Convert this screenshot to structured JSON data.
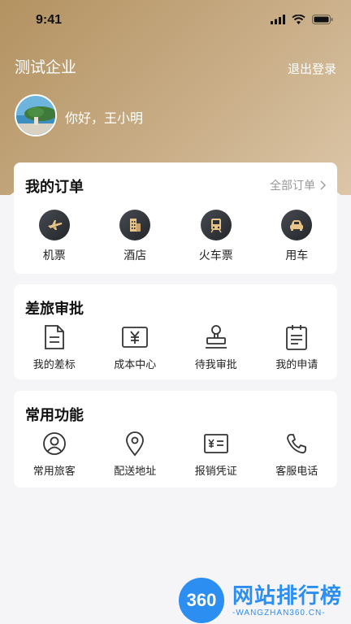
{
  "status_bar": {
    "time": "9:41"
  },
  "header": {
    "company": "测试企业",
    "logout": "退出登录",
    "greeting": "你好，王小明"
  },
  "orders": {
    "title": "我的订单",
    "all_link": "全部订单",
    "items": [
      {
        "label": "机票",
        "icon": "plane-icon"
      },
      {
        "label": "酒店",
        "icon": "hotel-icon"
      },
      {
        "label": "火车票",
        "icon": "train-icon"
      },
      {
        "label": "用车",
        "icon": "car-icon"
      }
    ]
  },
  "approval": {
    "title": "差旅审批",
    "items": [
      {
        "label": "我的差标",
        "icon": "document-icon"
      },
      {
        "label": "成本中心",
        "icon": "yuan-icon"
      },
      {
        "label": "待我审批",
        "icon": "stamp-icon"
      },
      {
        "label": "我的申请",
        "icon": "clipboard-icon"
      }
    ]
  },
  "functions": {
    "title": "常用功能",
    "items": [
      {
        "label": "常用旅客",
        "icon": "person-icon"
      },
      {
        "label": "配送地址",
        "icon": "location-icon"
      },
      {
        "label": "报销凭证",
        "icon": "receipt-icon"
      },
      {
        "label": "客服电话",
        "icon": "phone-icon"
      }
    ]
  },
  "watermark": {
    "logo": "360",
    "title": "网站排行榜",
    "subtitle": "-WANGZHAN360.CN-"
  },
  "colors": {
    "header_gold": "#b39261",
    "icon_dark": "#2d3035",
    "watermark_blue": "#2b8ef0"
  }
}
